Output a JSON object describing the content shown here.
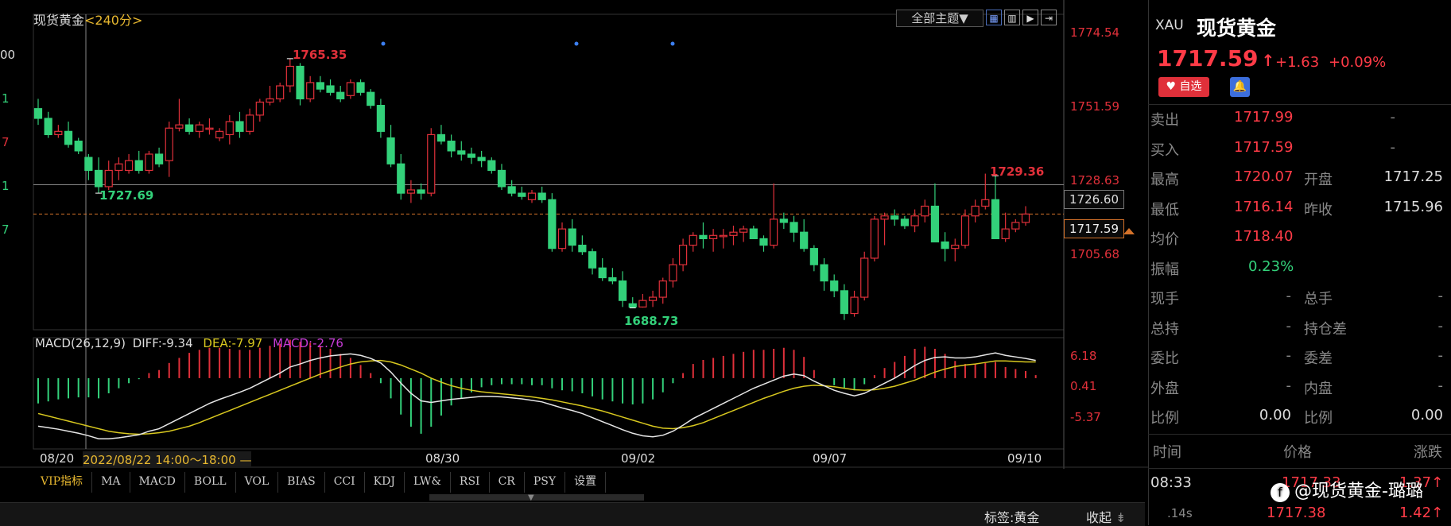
{
  "chart": {
    "title": "现货黄金",
    "period": "<240分>",
    "theme_label": "全部主题▼",
    "toolbar_icons": [
      "grid-icon",
      "columns-icon",
      "play-icon",
      "arrow-right-icon"
    ],
    "y_axis_labels": [
      "1774.54",
      "1751.59",
      "1728.63",
      "1705.68"
    ],
    "high_box": "1726.60",
    "current_box": "1717.59",
    "left_axis_partial": [
      "00",
      "1",
      "7",
      "1",
      "7"
    ],
    "annotations": {
      "high": "1765.35",
      "low_left": "1727.69",
      "low": "1688.73",
      "recent_high": "1729.36"
    },
    "macd": {
      "title": "MACD(26,12,9)",
      "diff": "DIFF:-9.34",
      "dea": "DEA:-7.97",
      "macd": "MACD:-2.76",
      "axis": [
        "6.18",
        "0.41",
        "-5.37"
      ]
    },
    "dates": [
      "08/20",
      "08/30",
      "09/02",
      "09/07",
      "09/10"
    ],
    "crosshair_label": "2022/08/22 14:00～18:00 —",
    "tabs": [
      "VIP指标",
      "MA",
      "MACD",
      "BOLL",
      "VOL",
      "BIAS",
      "CCI",
      "KDJ",
      "LW&",
      "RSI",
      "CR",
      "PSY",
      "设置"
    ],
    "tag": "标签:黄金",
    "collapse": "收起",
    "colors": {
      "up": "#e0303a",
      "down": "#33d17a",
      "macd_white": "#e6e6e6",
      "macd_yellow": "#d8c81f"
    }
  },
  "chart_data": {
    "type": "candlestick",
    "ohlc": [
      [
        1750,
        1753,
        1745,
        1747
      ],
      [
        1747,
        1749,
        1741,
        1742
      ],
      [
        1742,
        1745,
        1741,
        1743
      ],
      [
        1743,
        1746,
        1738,
        1739
      ],
      [
        1740,
        1741,
        1736,
        1737
      ],
      [
        1735,
        1736,
        1728,
        1731
      ],
      [
        1731,
        1735,
        1724,
        1726
      ],
      [
        1726,
        1734,
        1725,
        1731
      ],
      [
        1731,
        1735,
        1728,
        1733
      ],
      [
        1731,
        1736,
        1730,
        1734
      ],
      [
        1734,
        1737,
        1730,
        1731
      ],
      [
        1731,
        1737,
        1730,
        1736
      ],
      [
        1736,
        1738,
        1732,
        1733
      ],
      [
        1734,
        1746,
        1729,
        1744
      ],
      [
        1744,
        1753,
        1743,
        1745
      ],
      [
        1745,
        1747,
        1742,
        1743
      ],
      [
        1743,
        1746,
        1741,
        1745
      ],
      [
        1744,
        1747,
        1742,
        1744
      ],
      [
        1741,
        1744,
        1740,
        1743
      ],
      [
        1742,
        1748,
        1739,
        1746
      ],
      [
        1746,
        1749,
        1741,
        1743
      ],
      [
        1743,
        1750,
        1742,
        1748
      ],
      [
        1748,
        1753,
        1746,
        1752
      ],
      [
        1752,
        1757,
        1751,
        1753
      ],
      [
        1753,
        1758,
        1752,
        1757
      ],
      [
        1757,
        1765.35,
        1755,
        1763
      ],
      [
        1763,
        1764,
        1751,
        1753
      ],
      [
        1753,
        1760,
        1752,
        1758
      ],
      [
        1758,
        1760,
        1755,
        1756
      ],
      [
        1757,
        1759,
        1754,
        1755
      ],
      [
        1755,
        1757,
        1752,
        1753
      ],
      [
        1754,
        1759,
        1753,
        1758
      ],
      [
        1758,
        1759,
        1754,
        1755
      ],
      [
        1755,
        1756,
        1750,
        1751
      ],
      [
        1751,
        1753,
        1741,
        1743
      ],
      [
        1741,
        1745,
        1732,
        1733
      ],
      [
        1733,
        1736,
        1722,
        1724
      ],
      [
        1724,
        1728,
        1721,
        1725
      ],
      [
        1725,
        1727,
        1722,
        1724
      ],
      [
        1724,
        1744,
        1723,
        1742
      ],
      [
        1742,
        1745,
        1739,
        1740
      ],
      [
        1740,
        1742,
        1735,
        1737
      ],
      [
        1737,
        1740,
        1734,
        1736
      ],
      [
        1736,
        1738,
        1733,
        1735
      ],
      [
        1735,
        1737,
        1732,
        1734
      ],
      [
        1734,
        1735,
        1730,
        1731
      ],
      [
        1731,
        1733,
        1725,
        1726
      ],
      [
        1726,
        1728,
        1723,
        1724
      ],
      [
        1724,
        1726,
        1722,
        1723
      ],
      [
        1722,
        1725,
        1721,
        1724
      ],
      [
        1724,
        1726,
        1721,
        1722
      ],
      [
        1722,
        1724,
        1706,
        1707
      ],
      [
        1707,
        1715,
        1706,
        1713
      ],
      [
        1713,
        1716,
        1706,
        1708
      ],
      [
        1708,
        1711,
        1705,
        1706
      ],
      [
        1706,
        1707,
        1699,
        1701
      ],
      [
        1701,
        1704,
        1697,
        1698
      ],
      [
        1698,
        1701,
        1696,
        1697
      ],
      [
        1697,
        1700,
        1689,
        1691
      ],
      [
        1690,
        1692,
        1688.73,
        1689
      ],
      [
        1689,
        1693,
        1688.8,
        1691
      ],
      [
        1691,
        1694,
        1689,
        1692
      ],
      [
        1692,
        1698,
        1690,
        1697
      ],
      [
        1697,
        1704,
        1695,
        1702
      ],
      [
        1702,
        1710,
        1700,
        1708
      ],
      [
        1708,
        1712,
        1706,
        1711
      ],
      [
        1711,
        1715,
        1707,
        1710
      ],
      [
        1710,
        1713,
        1706,
        1711
      ],
      [
        1711,
        1713,
        1707,
        1711
      ],
      [
        1711,
        1714,
        1708,
        1712
      ],
      [
        1712,
        1714,
        1709,
        1713
      ],
      [
        1713,
        1714,
        1710,
        1710
      ],
      [
        1710,
        1711,
        1706,
        1708
      ],
      [
        1708,
        1727,
        1707,
        1716
      ],
      [
        1716,
        1718,
        1713,
        1715
      ],
      [
        1715,
        1717,
        1709,
        1712
      ],
      [
        1712,
        1716,
        1706,
        1707
      ],
      [
        1707,
        1708,
        1700,
        1702
      ],
      [
        1702,
        1704,
        1694,
        1697
      ],
      [
        1697,
        1699,
        1692,
        1694
      ],
      [
        1694,
        1696,
        1685,
        1687
      ],
      [
        1687,
        1694,
        1686,
        1692
      ],
      [
        1692,
        1706,
        1691,
        1704
      ],
      [
        1704,
        1717,
        1703,
        1716
      ],
      [
        1716,
        1718,
        1708,
        1717
      ],
      [
        1717,
        1719,
        1714,
        1716
      ],
      [
        1716,
        1717,
        1713,
        1714
      ],
      [
        1714,
        1719,
        1712,
        1717
      ],
      [
        1717,
        1722,
        1715,
        1720
      ],
      [
        1720,
        1727,
        1710,
        1709
      ],
      [
        1709,
        1712,
        1703,
        1707
      ],
      [
        1707,
        1710,
        1703,
        1708
      ],
      [
        1708,
        1719,
        1707,
        1717
      ],
      [
        1717,
        1722,
        1715,
        1720
      ],
      [
        1720,
        1730,
        1719,
        1722
      ],
      [
        1722,
        1729.36,
        1718,
        1710
      ],
      [
        1710,
        1718,
        1709,
        1713
      ],
      [
        1713,
        1716,
        1712,
        1715
      ],
      [
        1715,
        1720,
        1714,
        1717.59
      ]
    ],
    "y_range": [
      1682,
      1779
    ],
    "diff": [
      -9.5,
      -9.8,
      -10.1,
      -10.5,
      -10.9,
      -11.4,
      -12.0,
      -12.0,
      -11.8,
      -11.5,
      -11.2,
      -10.5,
      -10.0,
      -9.0,
      -8.0,
      -7.0,
      -6.0,
      -5.0,
      -4.2,
      -3.5,
      -2.8,
      -2.0,
      -1.0,
      0.0,
      1.0,
      2.2,
      2.8,
      3.5,
      4.0,
      4.4,
      4.6,
      4.8,
      4.5,
      3.9,
      3.0,
      1.2,
      -1.0,
      -3.0,
      -4.5,
      -4.8,
      -4.5,
      -4.2,
      -4.0,
      -3.8,
      -3.6,
      -3.6,
      -3.7,
      -3.9,
      -4.1,
      -4.4,
      -4.7,
      -5.3,
      -5.9,
      -6.4,
      -7.0,
      -7.8,
      -8.6,
      -9.4,
      -10.2,
      -10.9,
      -11.4,
      -11.6,
      -11.3,
      -10.5,
      -9.3,
      -8.0,
      -7.0,
      -6.0,
      -5.0,
      -4.0,
      -3.0,
      -2.0,
      -1.2,
      -0.4,
      0.4,
      0.8,
      0.5,
      -0.6,
      -1.5,
      -2.4,
      -3.0,
      -3.5,
      -3.0,
      -2.0,
      -1.0,
      0.0,
      1.2,
      2.5,
      3.5,
      4.1,
      4.2,
      4.0,
      4.0,
      4.2,
      4.6,
      5.0,
      4.5,
      4.2,
      3.9,
      3.5
    ],
    "dea": [
      -7.0,
      -7.5,
      -8.0,
      -8.5,
      -9.0,
      -9.5,
      -10.0,
      -10.5,
      -10.8,
      -11.0,
      -11.1,
      -11.0,
      -10.8,
      -10.5,
      -10.0,
      -9.5,
      -8.8,
      -8.0,
      -7.2,
      -6.4,
      -5.6,
      -4.8,
      -4.0,
      -3.2,
      -2.4,
      -1.6,
      -0.8,
      0.0,
      0.8,
      1.5,
      2.2,
      2.8,
      3.2,
      3.4,
      3.5,
      3.2,
      2.6,
      1.8,
      1.0,
      0.0,
      -0.8,
      -1.5,
      -2.0,
      -2.4,
      -2.7,
      -2.9,
      -3.1,
      -3.3,
      -3.5,
      -3.7,
      -4.0,
      -4.3,
      -4.7,
      -5.1,
      -5.5,
      -6.0,
      -6.5,
      -7.1,
      -7.7,
      -8.3,
      -8.9,
      -9.5,
      -9.9,
      -10.0,
      -9.8,
      -9.4,
      -8.8,
      -8.0,
      -7.2,
      -6.4,
      -5.6,
      -4.8,
      -4.0,
      -3.3,
      -2.6,
      -2.0,
      -1.6,
      -1.4,
      -1.5,
      -1.7,
      -2.0,
      -2.3,
      -2.4,
      -2.3,
      -2.0,
      -1.6,
      -1.0,
      -0.4,
      0.4,
      1.2,
      1.8,
      2.3,
      2.6,
      2.8,
      3.1,
      3.4,
      3.4,
      3.3,
      3.2,
      3.2
    ],
    "macd_y_range": [
      -14,
      8
    ]
  },
  "quote": {
    "symbol": "XAU",
    "name": "现货黄金",
    "price": "1717.59",
    "change": "+1.63",
    "change_pct": "+0.09%",
    "fav_label": "自选",
    "rows": [
      {
        "l1": "卖出",
        "v1": "1717.99",
        "l2": "",
        "v2": "-"
      },
      {
        "l1": "买入",
        "v1": "1717.59",
        "l2": "",
        "v2": "-"
      },
      {
        "l1": "最高",
        "v1": "1720.07",
        "l2": "开盘",
        "v2": "1717.25"
      },
      {
        "l1": "最低",
        "v1": "1716.14",
        "l2": "昨收",
        "v2": "1715.96"
      },
      {
        "l1": "均价",
        "v1": "1718.40",
        "l2": "",
        "v2": ""
      },
      {
        "l1": "振幅",
        "v1": "0.23%",
        "l2": "",
        "v2": ""
      },
      {
        "l1": "现手",
        "v1": "-",
        "l2": "总手",
        "v2": "-"
      },
      {
        "l1": "总持",
        "v1": "-",
        "l2": "持仓差",
        "v2": "-"
      },
      {
        "l1": "委比",
        "v1": "-",
        "l2": "委差",
        "v2": "-"
      },
      {
        "l1": "外盘",
        "v1": "-",
        "l2": "内盘",
        "v2": "-"
      },
      {
        "l1": "比例",
        "v1": "0.00",
        "l2": "比例",
        "v2": "0.00"
      }
    ],
    "tick_header": {
      "time": "时间",
      "price": "价格",
      "change": "涨跌"
    },
    "ticks": [
      {
        "time": "08:33",
        "price": "1717.33",
        "change": "1.37"
      },
      {
        "time": ".14s",
        "price": "1717.38",
        "change": "1.42"
      }
    ],
    "watermark": "@现货黄金-璐璐"
  }
}
